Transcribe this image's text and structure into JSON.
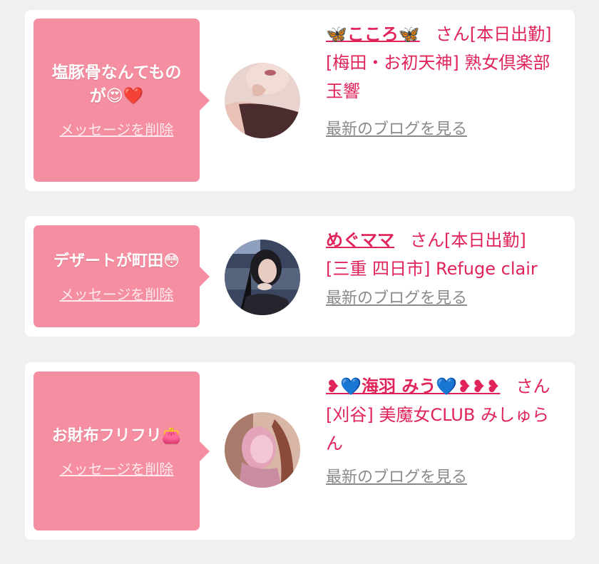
{
  "colors": {
    "background": "#f0f0f0",
    "card": "#ffffff",
    "bubble": "#f58ea0",
    "accent": "#e0245a",
    "link_gray": "#8a8a8a"
  },
  "messages": [
    {
      "message": "塩豚骨なんてものが😍❤️",
      "delete_label": "メッセージを削除",
      "avatar_icon": "profile-photo-woman-off-shoulder",
      "name": "🦋こころ🦋",
      "honorific": "さん",
      "status": "[本日出勤]",
      "shop": "[梅田・お初天神] 熟女倶楽部 玉響",
      "blog_link": "最新のブログを見る"
    },
    {
      "message": "デザートが町田😳",
      "delete_label": "メッセージを削除",
      "avatar_icon": "profile-photo-woman-dark-hair",
      "name": "めぐママ",
      "honorific": "さん",
      "status": "[本日出勤]",
      "shop": "[三重 四日市] Refuge clair",
      "blog_link": "最新のブログを見る"
    },
    {
      "message": "お財布フリフリ👛",
      "delete_label": "メッセージを削除",
      "avatar_icon": "profile-photo-pink-blurred",
      "name": "❥💙海羽 みう💙❥❥❥",
      "honorific": "さん",
      "status": "",
      "shop": "[刈谷] 美魔女CLUB みしゅらん",
      "blog_link": "最新のブログを見る"
    }
  ]
}
